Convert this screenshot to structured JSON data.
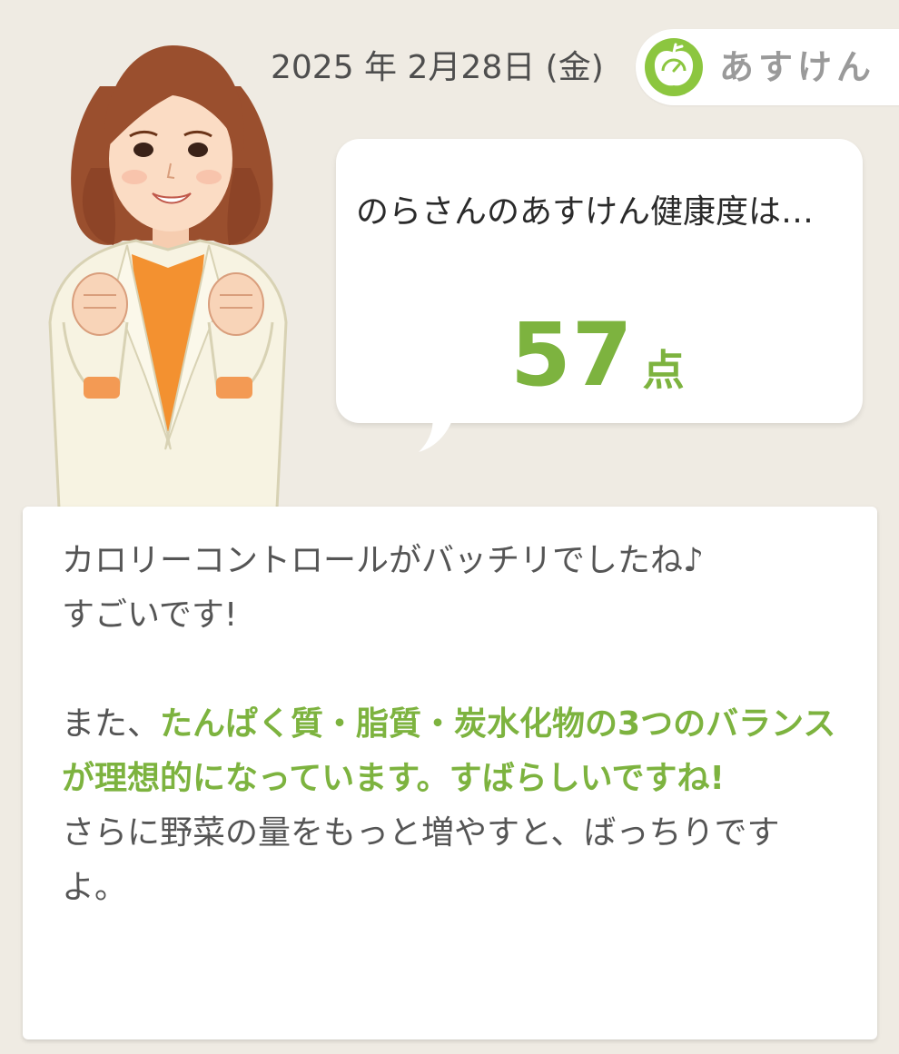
{
  "header": {
    "date": "2025 年 2月28日 (金)",
    "logo_text": "あすけん",
    "logo_icon": "apple-scale-icon"
  },
  "bubble": {
    "lead": "のらさんのあすけん健康度は…",
    "score": "57",
    "score_unit": "点"
  },
  "message": {
    "line1": "カロリーコントロールがバッチリでしたね♪",
    "line2": "すごいです!",
    "prefix": "また、",
    "highlight": "たんぱく質・脂質・炭水化物の3つのバランスが理想的になっています。すばらしいですね!",
    "advice": "さらに野菜の量をもっと増やすと、ばっちりですよ。"
  },
  "colors": {
    "background": "#efebe3",
    "accent_green": "#7db33f",
    "card": "#ffffff"
  }
}
